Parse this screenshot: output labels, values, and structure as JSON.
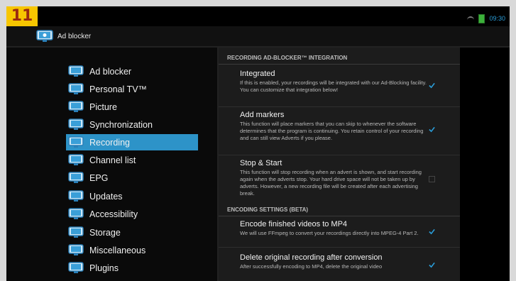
{
  "badge": "11",
  "status_bar": {
    "time": "09:30"
  },
  "action_bar": {
    "title": "Ad blocker"
  },
  "sidebar": {
    "items": [
      {
        "label": "Ad blocker"
      },
      {
        "label": "Personal TV™"
      },
      {
        "label": "Picture"
      },
      {
        "label": "Synchronization"
      },
      {
        "label": "Recording"
      },
      {
        "label": "Channel list"
      },
      {
        "label": "EPG"
      },
      {
        "label": "Updates"
      },
      {
        "label": "Accessibility"
      },
      {
        "label": "Storage"
      },
      {
        "label": "Miscellaneous"
      },
      {
        "label": "Plugins"
      }
    ],
    "selected": "Recording"
  },
  "sections": [
    {
      "header": "RECORDING AD-BLOCKER™ INTEGRATION",
      "prefs": [
        {
          "title": "Integrated",
          "summary": "If this is enabled, your recordings will be integrated with our Ad-Blocking facility. You can customize that integration below!",
          "checked": true
        },
        {
          "title": "Add markers",
          "summary": "This function will place markers that you can skip to whenever the software determines that the program is continuing. You retain control of your recording and can still view Adverts if you please.",
          "checked": true
        },
        {
          "title": "Stop & Start",
          "summary": "This function will stop recording when an advert is shown, and start recording again when the adverts stop. Your hard drive space will not be taken up by adverts. However, a new recording file will be created after each advertising break.",
          "checked": false
        }
      ]
    },
    {
      "header": "ENCODING SETTINGS (BETA)",
      "prefs": [
        {
          "title": "Encode finished videos to MP4",
          "summary": "We will use FFmpeg to convert your recordings directly into MPEG-4 Part 2.",
          "checked": true
        },
        {
          "title": "Delete original recording after conversion",
          "summary": "After successfully encoding to MP4, delete the original video",
          "checked": true
        }
      ]
    }
  ],
  "colors": {
    "accent": "#2d93c8",
    "badge_bg": "#f7c600",
    "badge_text": "#9a2a10",
    "check": "#2a9dd8"
  },
  "icons": {
    "app": "tv-app-icon",
    "sidebar": "tv-icon",
    "check": "check-icon",
    "battery": "battery-icon",
    "wifi": "wifi-icon"
  }
}
